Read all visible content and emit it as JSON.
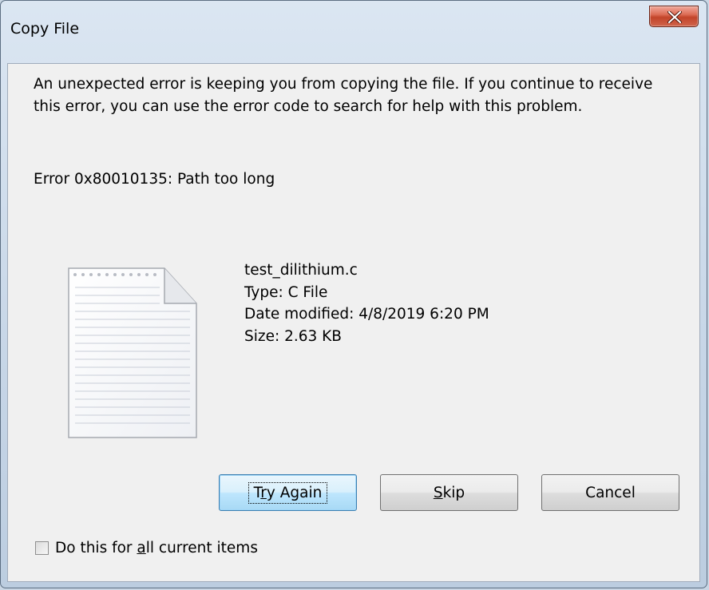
{
  "window": {
    "title": "Copy File"
  },
  "message": {
    "text": "An unexpected error is keeping you from copying the file. If you continue to receive this error, you can use the error code to search for help with this problem.",
    "error": "Error 0x80010135: Path too long"
  },
  "file": {
    "icon": "text-document-icon",
    "name": "test_dilithium.c",
    "type": "Type: C File",
    "modified": "Date modified: 4/8/2019 6:20 PM",
    "size": "Size: 2.63 KB"
  },
  "buttons": {
    "try_again": {
      "before": "T",
      "accel": "r",
      "after": "y Again"
    },
    "skip": {
      "accel": "S",
      "after": "kip"
    },
    "cancel": "Cancel"
  },
  "checkbox": {
    "before": "Do this for ",
    "accel": "a",
    "after": "ll current items",
    "checked": false
  },
  "colors": {
    "close_button": "#c2442a",
    "default_button_border": "#3c7fb1",
    "dialog_background": "#f0f0f0"
  }
}
